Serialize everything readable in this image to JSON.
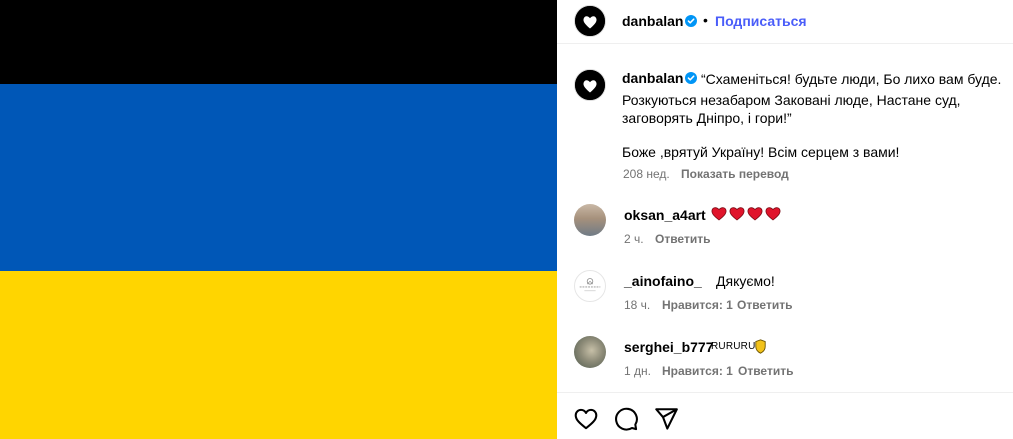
{
  "media": {
    "flag_colors": [
      "#000000",
      "#0057b7",
      "#ffd500"
    ]
  },
  "header": {
    "username": "danbalan",
    "separator": "•",
    "follow_label": "Подписаться",
    "verified_icon": "verified-badge-icon"
  },
  "caption": {
    "username": "danbalan",
    "text_line1": "“Схаменіться! будьте люди, Бо лихо вам буде.",
    "text_line2": "Розкуються незабаром Заковані люде, Настане суд,",
    "text_line3": "заговорять Дніпро, і гори!”",
    "text_line4": "Боже ,врятуй Україну! Всім серцем з вами!",
    "time": "208 нед.",
    "translate_label": "Показать перевод"
  },
  "comments": [
    {
      "username": "oksan_a4art",
      "text": "",
      "emoji": "heart-red-icon x4",
      "time": "2 ч.",
      "likes": "",
      "reply_label": "Ответить"
    },
    {
      "username": "_ainofaino_",
      "text": "Дякуємо!",
      "time": "18 ч.",
      "likes": "Нравится: 1",
      "reply_label": "Ответить"
    },
    {
      "username": "serghei_b777",
      "text": "RURURU",
      "emoji": "shield-yellow-icon",
      "time": "1 дн.",
      "likes": "Нравится: 1",
      "reply_label": "Ответить"
    }
  ],
  "actions": {
    "like_icon": "heart-outline-icon",
    "comment_icon": "comment-bubble-icon",
    "share_icon": "paper-plane-icon"
  },
  "colors": {
    "link_blue": "#4a5df9",
    "meta_gray": "#737373",
    "verified_blue": "#0095f6"
  }
}
